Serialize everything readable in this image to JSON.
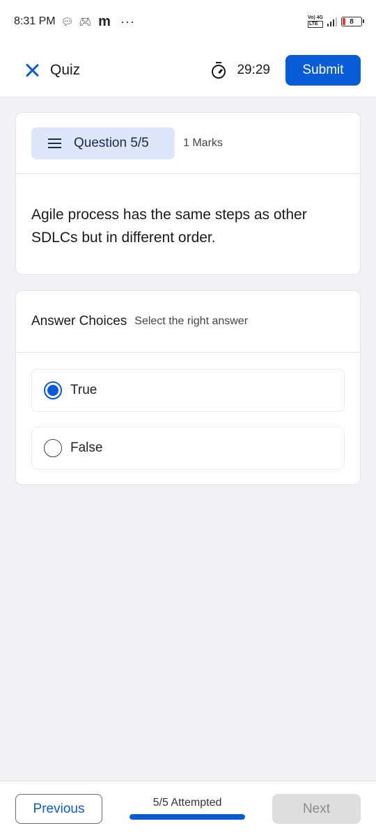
{
  "status_bar": {
    "time": "8:31 PM",
    "notification_letter": "m",
    "more": "···",
    "network_top": "Vo) 4G",
    "network_bottom": "LTE",
    "battery_level": "8"
  },
  "header": {
    "title": "Quiz",
    "timer": "29:29",
    "submit_label": "Submit"
  },
  "question": {
    "label": "Question 5/5",
    "marks": "1 Marks",
    "text": "Agile process has the same steps as other SDLCs but in different order."
  },
  "answers": {
    "title": "Answer Choices",
    "subtitle": "Select the right answer",
    "choices": [
      {
        "label": "True",
        "selected": true
      },
      {
        "label": "False",
        "selected": false
      }
    ]
  },
  "footer": {
    "previous_label": "Previous",
    "attempted_text": "5/5 Attempted",
    "progress_fraction": 1.0,
    "next_label": "Next"
  },
  "colors": {
    "accent": "#0a5bd6",
    "pill_bg": "#dde6fb",
    "page_bg": "#f2f2f6",
    "disabled_bg": "#dedede"
  }
}
